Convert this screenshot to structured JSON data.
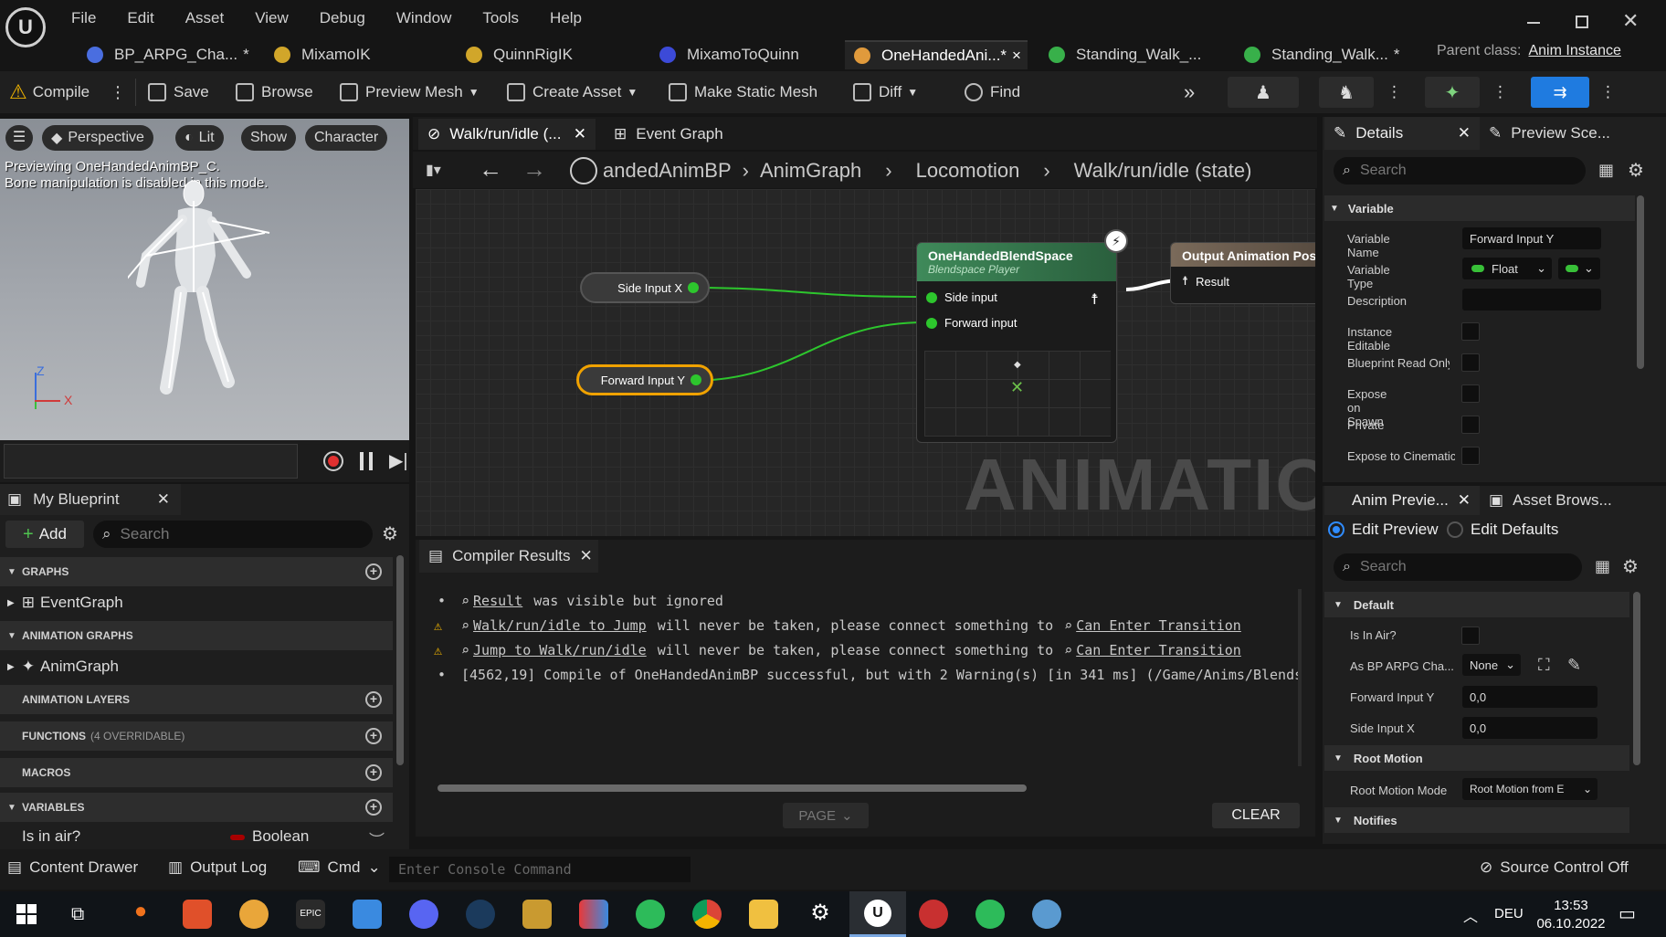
{
  "menu": [
    "File",
    "Edit",
    "Asset",
    "View",
    "Debug",
    "Window",
    "Tools",
    "Help"
  ],
  "tabs": [
    {
      "label": "BP_ARPG_Cha...",
      "modified": "*",
      "color": "#4a6ee0"
    },
    {
      "label": "MixamoIK",
      "modified": "",
      "color": "#d1a62a"
    },
    {
      "label": "QuinnRigIK",
      "modified": "",
      "color": "#d1a62a"
    },
    {
      "label": "MixamoToQuinn",
      "modified": "",
      "color": "#3c4ad8"
    },
    {
      "label": "OneHandedAni...",
      "modified": "*",
      "close": "×",
      "color": "#e09a3c"
    },
    {
      "label": "Standing_Walk_...",
      "modified": "",
      "color": "#38b04a"
    },
    {
      "label": "Standing_Walk...",
      "modified": "*",
      "color": "#38b04a"
    }
  ],
  "parent_class": {
    "label": "Parent class:",
    "value": "Anim Instance"
  },
  "toolbar": {
    "compile": "Compile",
    "save": "Save",
    "browse": "Browse",
    "preview_mesh": "Preview Mesh",
    "create_asset": "Create Asset",
    "make_static_mesh": "Make Static Mesh",
    "diff": "Diff",
    "find": "Find"
  },
  "viewport": {
    "perspective": "Perspective",
    "lit": "Lit",
    "show": "Show",
    "character": "Character",
    "message1": "Previewing OneHandedAnimBP_C.",
    "message2": "Bone manipulation is disabled in this mode.",
    "axis_z": "Z",
    "axis_x": "X"
  },
  "graph_tabs": {
    "walk": "Walk/run/idle (...",
    "event": "Event Graph"
  },
  "breadcrumb": [
    "andedAnimBP",
    "AnimGraph",
    "Locomotion",
    "Walk/run/idle (state)"
  ],
  "nodes": {
    "side_input": "Side Input X",
    "forward_input": "Forward Input Y",
    "blendspace_title": "OneHandedBlendSpace",
    "blendspace_sub": "Blendspace Player",
    "side_pin": "Side input",
    "forward_pin": "Forward input",
    "output_title": "Output Animation Pos",
    "result": "Result",
    "watermark": "ANIMATION"
  },
  "my_blueprint": {
    "title": "My Blueprint",
    "add": "Add",
    "search": "Search",
    "graphs": "GRAPHS",
    "event_graph": "EventGraph",
    "anim_graphs": "ANIMATION GRAPHS",
    "anim_graph": "AnimGraph",
    "anim_layers": "ANIMATION LAYERS",
    "functions": "FUNCTIONS",
    "functions_note": "(4 OVERRIDABLE)",
    "macros": "MACROS",
    "variables": "VARIABLES",
    "var_name": "Is in air?",
    "var_type": "Boolean"
  },
  "compiler": {
    "title": "Compiler Results",
    "lines": [
      {
        "kind": "info",
        "link": "Result",
        "text": "was visible but ignored"
      },
      {
        "kind": "warn",
        "link": "Walk/run/idle to Jump",
        "text": "will never be taken, please connect something to",
        "link2": "Can Enter Transition"
      },
      {
        "kind": "warn",
        "link": "Jump to Walk/run/idle",
        "text": "will never be taken, please connect something to",
        "link2": "Can Enter Transition"
      },
      {
        "kind": "info",
        "text": "[4562,19] Compile of OneHandedAnimBP successful, but with 2 Warning(s) [in 341 ms] (/Game/Anims/Blends"
      }
    ],
    "page": "PAGE",
    "clear": "CLEAR"
  },
  "details": {
    "tab": "Details",
    "tab2": "Preview Sce...",
    "search": "Search",
    "section": "Variable",
    "rows": [
      {
        "label": "Variable Name",
        "value": "Forward Input Y"
      },
      {
        "label": "Variable Type",
        "value": "Float"
      },
      {
        "label": "Description",
        "value": ""
      },
      {
        "label": "Instance Editable"
      },
      {
        "label": "Blueprint Read Only"
      },
      {
        "label": "Expose on Spawn"
      },
      {
        "label": "Private"
      },
      {
        "label": "Expose to Cinematics"
      }
    ]
  },
  "anim_preview": {
    "tab": "Anim Previe...",
    "tab2": "Asset Brows...",
    "edit_preview": "Edit Preview",
    "edit_defaults": "Edit Defaults",
    "search": "Search",
    "default": "Default",
    "is_in_air": "Is In Air?",
    "as_bp": "As BP ARPG Cha...",
    "as_bp_value": "None",
    "forward": "Forward Input Y",
    "forward_value": "0,0",
    "side": "Side Input X",
    "side_value": "0,0",
    "root_motion": "Root Motion",
    "root_motion_mode": "Root Motion Mode",
    "root_motion_value": "Root Motion from E",
    "notifies": "Notifies"
  },
  "status": {
    "content_drawer": "Content Drawer",
    "output_log": "Output Log",
    "cmd": "Cmd",
    "console": "Enter Console Command",
    "source_control": "Source Control Off"
  },
  "taskbar": {
    "lang": "DEU",
    "time": "13:53",
    "date": "06.10.2022"
  }
}
